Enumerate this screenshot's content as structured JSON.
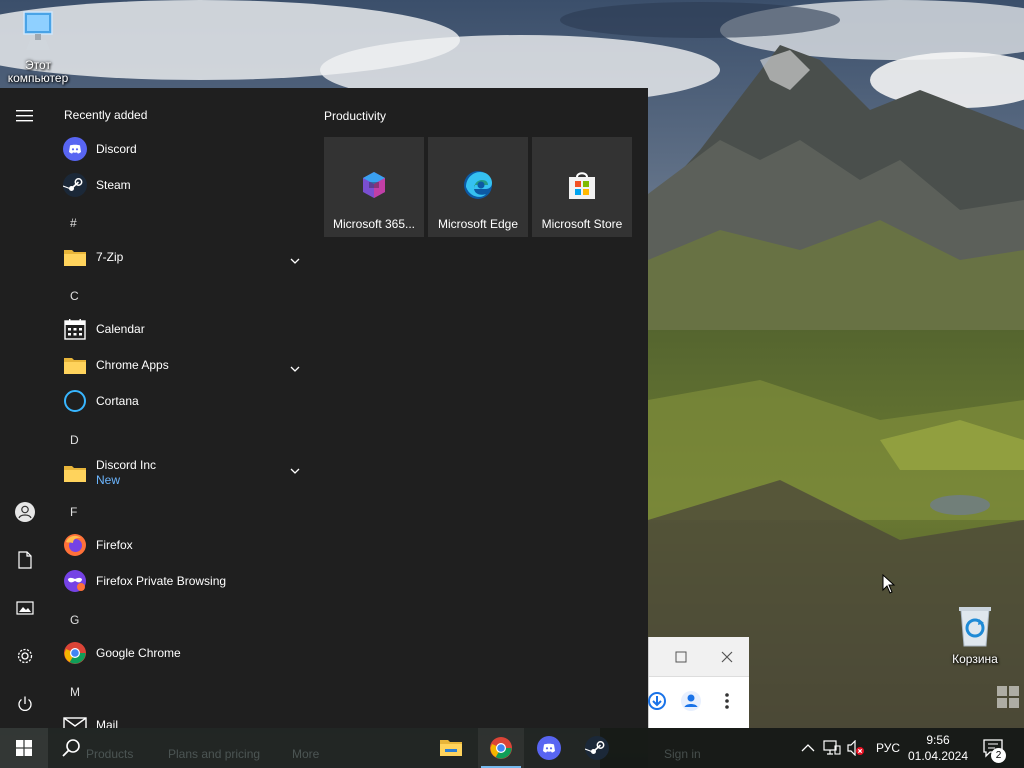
{
  "desktop": {
    "icons": [
      {
        "label_line1": "Этот",
        "label_line2": "компьютер",
        "icon": "this-pc-icon"
      },
      {
        "label": "Корзина",
        "icon": "recycle-bin-icon"
      }
    ]
  },
  "start_menu": {
    "list_header": "Recently added",
    "letters": [
      "#",
      "C",
      "D",
      "F",
      "G",
      "M"
    ],
    "apps": [
      {
        "label": "Discord",
        "icon": "discord-icon"
      },
      {
        "label": "Steam",
        "icon": "steam-icon"
      },
      {
        "label": "7-Zip",
        "icon": "folder-icon",
        "expandable": true
      },
      {
        "label": "Calendar",
        "icon": "calendar-icon"
      },
      {
        "label": "Chrome Apps",
        "icon": "folder-icon",
        "expandable": true
      },
      {
        "label": "Cortana",
        "icon": "cortana-icon"
      },
      {
        "label": "Discord Inc",
        "sub": "New",
        "icon": "folder-icon",
        "expandable": true
      },
      {
        "label": "Firefox",
        "icon": "firefox-icon"
      },
      {
        "label": "Firefox Private Browsing",
        "icon": "firefox-private-icon"
      },
      {
        "label": "Google Chrome",
        "icon": "chrome-icon"
      },
      {
        "label": "Mail",
        "icon": "mail-icon"
      }
    ],
    "tiles_header": "Productivity",
    "tiles": [
      {
        "label": "Microsoft 365...",
        "icon": "microsoft-365-icon"
      },
      {
        "label": "Microsoft Edge",
        "icon": "edge-icon"
      },
      {
        "label": "Microsoft Store",
        "icon": "store-icon"
      }
    ]
  },
  "taskbar": {
    "ghost_labels": [
      "Products",
      "Plans and pricing",
      "More",
      "Sign in"
    ],
    "language": "РУС",
    "time": "9:56",
    "date": "01.04.2024",
    "notification_count": "2"
  },
  "colors": {
    "menu_bg": "#1f1f1f",
    "tile_bg": "#333333",
    "accent": "#76b9ed",
    "new_badge": "#6cb6ff"
  }
}
